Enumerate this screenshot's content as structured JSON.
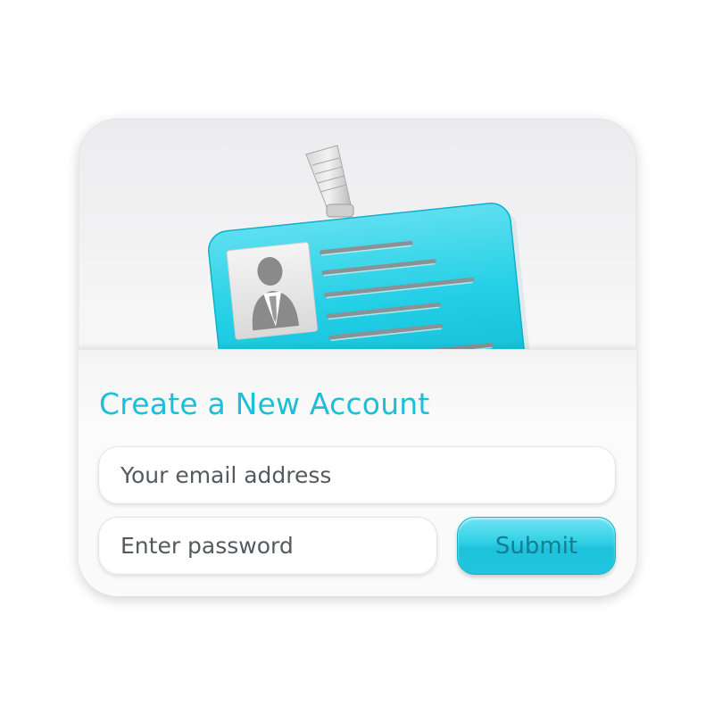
{
  "form": {
    "title": "Create a New Account",
    "email_placeholder": "Your email address",
    "password_placeholder": "Enter password",
    "submit_label": "Submit"
  },
  "colors": {
    "accent": "#1dbfd6",
    "badge": "#21cde3",
    "submit_text": "#127d93",
    "field_text": "#555a5e",
    "card_bg": "#f5f5f6"
  },
  "icons": {
    "illustration": "id-badge-icon",
    "person": "person-silhouette-icon",
    "clip": "badge-clip-icon"
  }
}
